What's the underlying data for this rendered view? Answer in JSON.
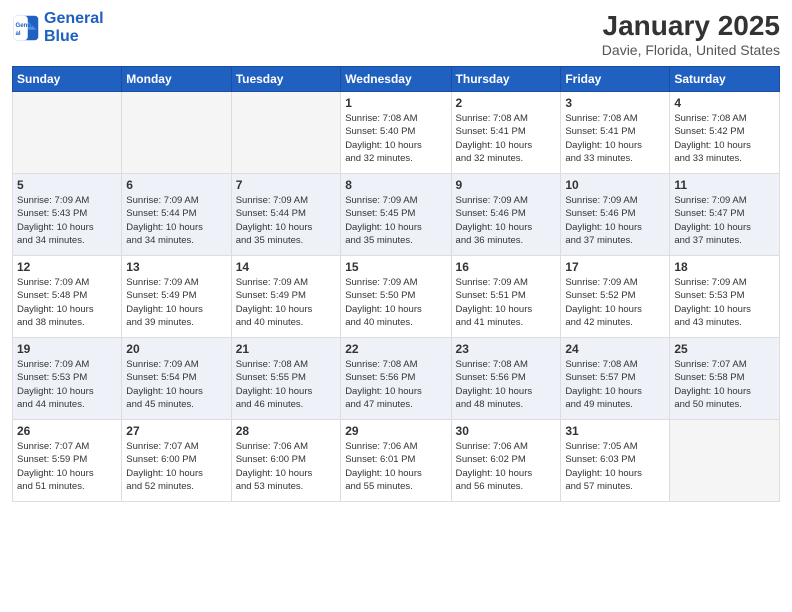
{
  "header": {
    "logo_line1": "General",
    "logo_line2": "Blue",
    "month": "January 2025",
    "location": "Davie, Florida, United States"
  },
  "days_of_week": [
    "Sunday",
    "Monday",
    "Tuesday",
    "Wednesday",
    "Thursday",
    "Friday",
    "Saturday"
  ],
  "weeks": [
    {
      "alt": false,
      "days": [
        {
          "num": "",
          "info": ""
        },
        {
          "num": "",
          "info": ""
        },
        {
          "num": "",
          "info": ""
        },
        {
          "num": "1",
          "info": "Sunrise: 7:08 AM\nSunset: 5:40 PM\nDaylight: 10 hours\nand 32 minutes."
        },
        {
          "num": "2",
          "info": "Sunrise: 7:08 AM\nSunset: 5:41 PM\nDaylight: 10 hours\nand 32 minutes."
        },
        {
          "num": "3",
          "info": "Sunrise: 7:08 AM\nSunset: 5:41 PM\nDaylight: 10 hours\nand 33 minutes."
        },
        {
          "num": "4",
          "info": "Sunrise: 7:08 AM\nSunset: 5:42 PM\nDaylight: 10 hours\nand 33 minutes."
        }
      ]
    },
    {
      "alt": true,
      "days": [
        {
          "num": "5",
          "info": "Sunrise: 7:09 AM\nSunset: 5:43 PM\nDaylight: 10 hours\nand 34 minutes."
        },
        {
          "num": "6",
          "info": "Sunrise: 7:09 AM\nSunset: 5:44 PM\nDaylight: 10 hours\nand 34 minutes."
        },
        {
          "num": "7",
          "info": "Sunrise: 7:09 AM\nSunset: 5:44 PM\nDaylight: 10 hours\nand 35 minutes."
        },
        {
          "num": "8",
          "info": "Sunrise: 7:09 AM\nSunset: 5:45 PM\nDaylight: 10 hours\nand 35 minutes."
        },
        {
          "num": "9",
          "info": "Sunrise: 7:09 AM\nSunset: 5:46 PM\nDaylight: 10 hours\nand 36 minutes."
        },
        {
          "num": "10",
          "info": "Sunrise: 7:09 AM\nSunset: 5:46 PM\nDaylight: 10 hours\nand 37 minutes."
        },
        {
          "num": "11",
          "info": "Sunrise: 7:09 AM\nSunset: 5:47 PM\nDaylight: 10 hours\nand 37 minutes."
        }
      ]
    },
    {
      "alt": false,
      "days": [
        {
          "num": "12",
          "info": "Sunrise: 7:09 AM\nSunset: 5:48 PM\nDaylight: 10 hours\nand 38 minutes."
        },
        {
          "num": "13",
          "info": "Sunrise: 7:09 AM\nSunset: 5:49 PM\nDaylight: 10 hours\nand 39 minutes."
        },
        {
          "num": "14",
          "info": "Sunrise: 7:09 AM\nSunset: 5:49 PM\nDaylight: 10 hours\nand 40 minutes."
        },
        {
          "num": "15",
          "info": "Sunrise: 7:09 AM\nSunset: 5:50 PM\nDaylight: 10 hours\nand 40 minutes."
        },
        {
          "num": "16",
          "info": "Sunrise: 7:09 AM\nSunset: 5:51 PM\nDaylight: 10 hours\nand 41 minutes."
        },
        {
          "num": "17",
          "info": "Sunrise: 7:09 AM\nSunset: 5:52 PM\nDaylight: 10 hours\nand 42 minutes."
        },
        {
          "num": "18",
          "info": "Sunrise: 7:09 AM\nSunset: 5:53 PM\nDaylight: 10 hours\nand 43 minutes."
        }
      ]
    },
    {
      "alt": true,
      "days": [
        {
          "num": "19",
          "info": "Sunrise: 7:09 AM\nSunset: 5:53 PM\nDaylight: 10 hours\nand 44 minutes."
        },
        {
          "num": "20",
          "info": "Sunrise: 7:09 AM\nSunset: 5:54 PM\nDaylight: 10 hours\nand 45 minutes."
        },
        {
          "num": "21",
          "info": "Sunrise: 7:08 AM\nSunset: 5:55 PM\nDaylight: 10 hours\nand 46 minutes."
        },
        {
          "num": "22",
          "info": "Sunrise: 7:08 AM\nSunset: 5:56 PM\nDaylight: 10 hours\nand 47 minutes."
        },
        {
          "num": "23",
          "info": "Sunrise: 7:08 AM\nSunset: 5:56 PM\nDaylight: 10 hours\nand 48 minutes."
        },
        {
          "num": "24",
          "info": "Sunrise: 7:08 AM\nSunset: 5:57 PM\nDaylight: 10 hours\nand 49 minutes."
        },
        {
          "num": "25",
          "info": "Sunrise: 7:07 AM\nSunset: 5:58 PM\nDaylight: 10 hours\nand 50 minutes."
        }
      ]
    },
    {
      "alt": false,
      "days": [
        {
          "num": "26",
          "info": "Sunrise: 7:07 AM\nSunset: 5:59 PM\nDaylight: 10 hours\nand 51 minutes."
        },
        {
          "num": "27",
          "info": "Sunrise: 7:07 AM\nSunset: 6:00 PM\nDaylight: 10 hours\nand 52 minutes."
        },
        {
          "num": "28",
          "info": "Sunrise: 7:06 AM\nSunset: 6:00 PM\nDaylight: 10 hours\nand 53 minutes."
        },
        {
          "num": "29",
          "info": "Sunrise: 7:06 AM\nSunset: 6:01 PM\nDaylight: 10 hours\nand 55 minutes."
        },
        {
          "num": "30",
          "info": "Sunrise: 7:06 AM\nSunset: 6:02 PM\nDaylight: 10 hours\nand 56 minutes."
        },
        {
          "num": "31",
          "info": "Sunrise: 7:05 AM\nSunset: 6:03 PM\nDaylight: 10 hours\nand 57 minutes."
        },
        {
          "num": "",
          "info": ""
        }
      ]
    }
  ]
}
